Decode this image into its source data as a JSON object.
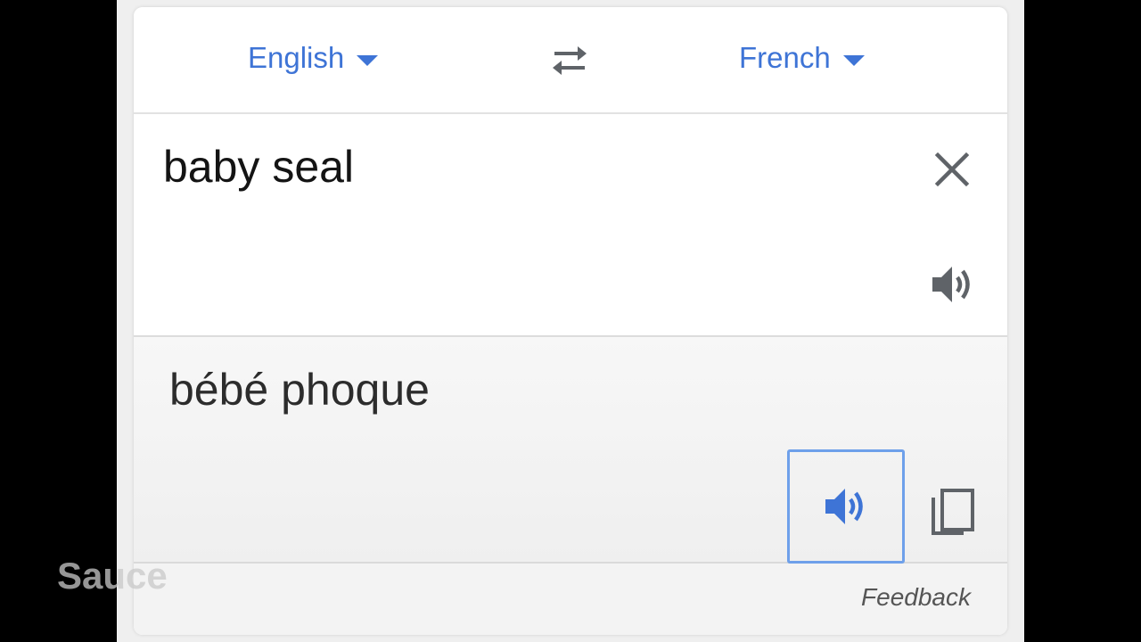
{
  "languages": {
    "source": "English",
    "target": "French"
  },
  "source": {
    "text": "baby seal"
  },
  "translation": {
    "text": "bébé phoque"
  },
  "footer": {
    "feedback_label": "Feedback"
  },
  "watermark": "Sauce",
  "icons": {
    "swap": "swap-arrows-icon",
    "clear": "close-icon",
    "source_speaker": "speaker-icon",
    "target_speaker": "speaker-icon",
    "copy": "copy-icon"
  },
  "colors": {
    "accent": "#3e74d6",
    "focus_ring": "#6ea0ea",
    "icon_gray": "#5f6368"
  }
}
